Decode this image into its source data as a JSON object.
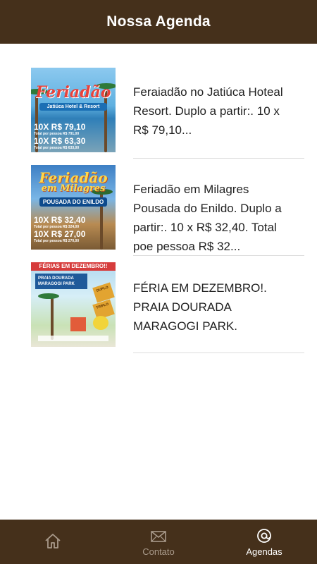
{
  "header": {
    "title": "Nossa Agenda"
  },
  "items": [
    {
      "text": "Feraiadão no Jatiúca Hoteal Resort. Duplo a partir:. 10 x R$ 79,10...",
      "thumb": {
        "title": "Feriadão",
        "subtitle": "Jatiúca Hotel & Resort",
        "price1": "10X R$ 79,10",
        "price1_note": "Total por pessoa R$ 791,00",
        "price2": "10X R$ 63,30",
        "price2_note": "Total por pessoa R$ 633,00"
      }
    },
    {
      "text": "Feriadão em Milagres Pousada do Enildo. Duplo a partir:. 10 x R$ 32,40. Total poe pessoa R$ 32...",
      "thumb": {
        "title": "Feriadão",
        "title2": "em Milagres",
        "subtitle": "POUSADA DO ENILDO",
        "price1": "10X R$ 32,40",
        "price1_note": "Total por pessoa R$ 324,00",
        "price2": "10X R$ 27,00",
        "price2_note": "Total por pessoa R$ 270,00"
      }
    },
    {
      "text": "FÉRIA EM DEZEMBRO!. PRAIA DOURADA MARAGOGI PARK.",
      "thumb": {
        "banner": "FÉRIAS EM DEZEMBRO!!",
        "title": "PRAIA DOURADA MARAGOGI PARK",
        "tag1": "DUPLO",
        "tag2": "TRIPLO"
      }
    }
  ],
  "tabs": [
    {
      "label": "",
      "icon": "home-icon",
      "active": false
    },
    {
      "label": "Contato",
      "icon": "envelope-icon",
      "active": false
    },
    {
      "label": "Agendas",
      "icon": "at-icon",
      "active": true
    }
  ],
  "colors": {
    "bar": "#45301b",
    "active_tab": "#ffffff",
    "inactive_tab": "#a99a8b"
  }
}
